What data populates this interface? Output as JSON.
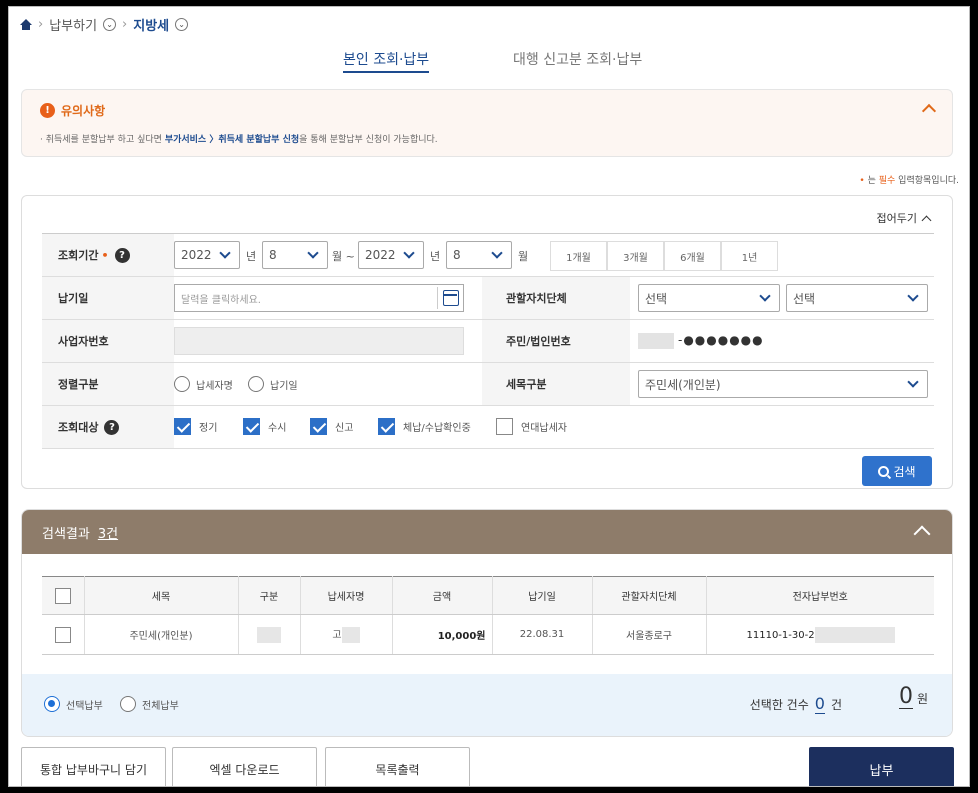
{
  "breadcrumb": {
    "level1": "납부하기",
    "level2": "지방세"
  },
  "tabs": {
    "self": "본인 조회·납부",
    "proxy": "대행 신고분 조회·납부"
  },
  "notice": {
    "title": "유의사항",
    "text_prefix": "· 취득세를 분할납부 하고 싶다면 ",
    "link": "부가서비스 〉취득세 분할납부 신청",
    "text_suffix": "을 통해 분할납부 신청이 가능합니다."
  },
  "required_note": {
    "prefix": " 는 ",
    "red": "필수",
    "suffix": " 입력항목입니다."
  },
  "search": {
    "fold_label": "접어두기",
    "period_label": "조회기간",
    "start_year": "2022",
    "start_month": "8",
    "end_year": "2022",
    "end_month": "8",
    "year_unit": "년",
    "month_unit_tilde": "월 ~",
    "month_unit": "월",
    "periods": [
      "1개월",
      "3개월",
      "6개월",
      "1년"
    ],
    "pay_date_label": "납기일",
    "pay_date_placeholder": "달력을 클릭하세요.",
    "local_gov_label": "관할자치단체",
    "local_gov_sel1": "선택",
    "local_gov_sel2": "선택",
    "biz_no_label": "사업자번호",
    "resident_no_label": "주민/법인번호",
    "resident_no_masked": "-●●●●●●●",
    "sort_label": "정렬구분",
    "sort_options": [
      "납세자명",
      "납기일"
    ],
    "tax_item_label": "세목구분",
    "tax_item_value": "주민세(개인분)",
    "target_label": "조회대상",
    "targets": [
      {
        "label": "정기",
        "checked": true
      },
      {
        "label": "수시",
        "checked": true
      },
      {
        "label": "신고",
        "checked": true
      },
      {
        "label": "체납/수납확인중",
        "checked": true
      },
      {
        "label": "연대납세자",
        "checked": false
      }
    ],
    "search_button": "검색"
  },
  "results": {
    "title": "검색결과",
    "count": "3건",
    "columns": [
      "세목",
      "구분",
      "납세자명",
      "금액",
      "납기일",
      "관할자치단체",
      "전자납부번호"
    ],
    "rows": [
      {
        "tax": "주민세(개인분)",
        "name_prefix": "고",
        "amount": "10,000원",
        "due": "22.08.31",
        "gov": "서울종로구",
        "epay_prefix": "11110-1-30-2"
      }
    ],
    "pay_options": [
      "선택납부",
      "전체납부"
    ],
    "selected_count_label": "선택한 건수",
    "selected_count": "0",
    "count_unit": "건",
    "total": "0",
    "won": "원"
  },
  "actions": {
    "cart": "통합 납부바구니 담기",
    "excel": "엑셀 다운로드",
    "print": "목록출력",
    "pay": "납부"
  }
}
